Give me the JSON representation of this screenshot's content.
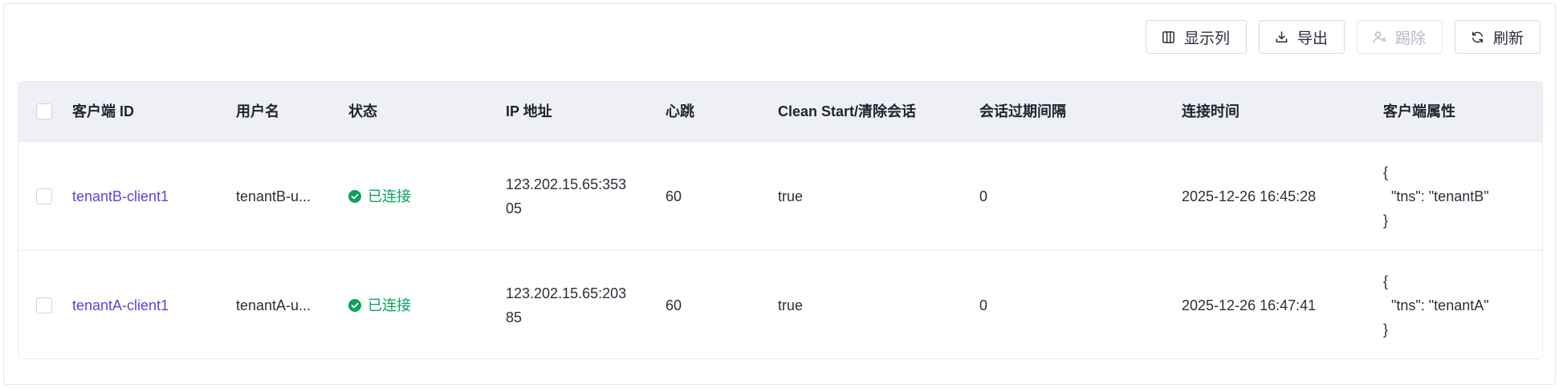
{
  "toolbar": {
    "columns_label": "显示列",
    "export_label": "导出",
    "kick_label": "踢除",
    "refresh_label": "刷新"
  },
  "table": {
    "headers": {
      "client_id": "客户端 ID",
      "username": "用户名",
      "status": "状态",
      "ip": "IP 地址",
      "heartbeat": "心跳",
      "clean_start": "Clean Start/清除会话",
      "session_expiry": "会话过期间隔",
      "connected_at": "连接时间",
      "attributes": "客户端属性"
    },
    "rows": [
      {
        "client_id": "tenantB-client1",
        "username": "tenantB-u...",
        "status": "已连接",
        "ip": "123.202.15.65:35305",
        "heartbeat": "60",
        "clean_start": "true",
        "session_expiry": "0",
        "connected_at": "2025-12-26 16:45:28",
        "attributes": "{\n  \"tns\": \"tenantB\"\n}"
      },
      {
        "client_id": "tenantA-client1",
        "username": "tenantA-u...",
        "status": "已连接",
        "ip": "123.202.15.65:20385",
        "heartbeat": "60",
        "clean_start": "true",
        "session_expiry": "0",
        "connected_at": "2025-12-26 16:47:41",
        "attributes": "{\n  \"tns\": \"tenantA\"\n}"
      }
    ]
  },
  "colors": {
    "link": "#5b43e0",
    "connected": "#0aa35b",
    "header_bg": "#eef0f5"
  },
  "icons": {
    "columns": "columns-icon",
    "export": "download-icon",
    "kick": "user-remove-icon",
    "refresh": "refresh-icon",
    "status": "check-circle-icon"
  }
}
